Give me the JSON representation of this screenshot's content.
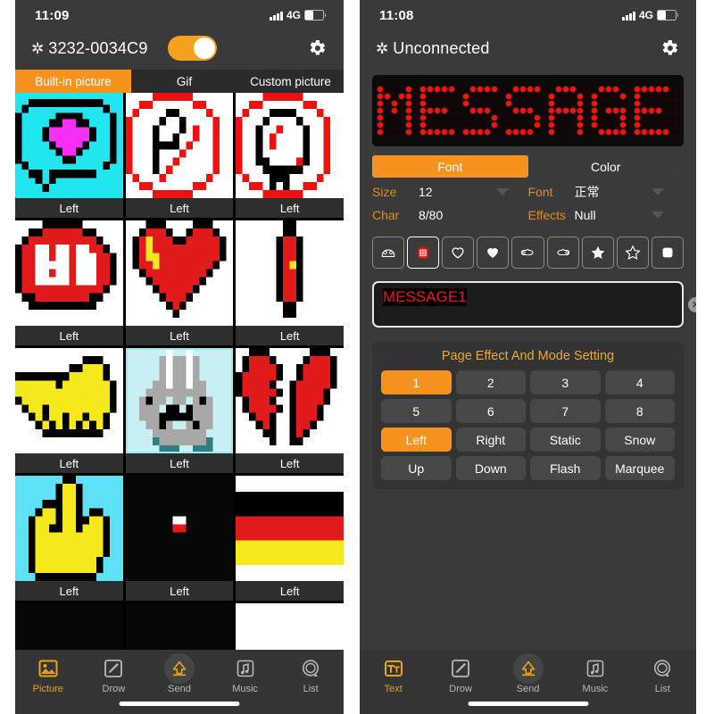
{
  "left": {
    "status": {
      "time": "11:09",
      "network": "4G"
    },
    "device": {
      "name": "3232-0034C9",
      "bluetooth_icon": "bluetooth-icon",
      "toggle_on": true,
      "gear_icon": "gear-icon"
    },
    "tabs": [
      {
        "label": "Built-in picture",
        "active": true
      },
      {
        "label": "Gif",
        "active": false
      },
      {
        "label": "Custom picture",
        "active": false
      }
    ],
    "gallery": [
      {
        "caption": "Left",
        "art": "speech-bubble-heart",
        "selected": false
      },
      {
        "caption": "Left",
        "art": "no-parking",
        "selected": false
      },
      {
        "caption": "Left",
        "art": "no-u-turn",
        "selected": false
      },
      {
        "caption": "Left",
        "art": "stop-sign",
        "selected": false
      },
      {
        "caption": "Left",
        "art": "heart-red",
        "selected": false
      },
      {
        "caption": "Left",
        "art": "vertical-bar",
        "selected": false
      },
      {
        "caption": "Left",
        "art": "handshake",
        "selected": false
      },
      {
        "caption": "Left",
        "art": "rabbit",
        "selected": true
      },
      {
        "caption": "Left",
        "art": "broken-heart",
        "selected": false
      },
      {
        "caption": "Left",
        "art": "pointing-up-hand",
        "selected": false
      },
      {
        "caption": "Left",
        "art": "red-dot",
        "selected": false
      },
      {
        "caption": "Left",
        "art": "flag-germany",
        "selected": false
      },
      {
        "caption": "",
        "art": "red-white-shape",
        "selected": false
      },
      {
        "caption": "",
        "art": "flag-stripes",
        "selected": false
      },
      {
        "caption": "",
        "art": "white-pattern",
        "selected": false
      }
    ],
    "nav": [
      {
        "label": "Picture",
        "icon": "picture-icon",
        "active": true
      },
      {
        "label": "Drow",
        "icon": "pencil-icon",
        "active": false
      },
      {
        "label": "Send",
        "icon": "upload-icon",
        "active": false
      },
      {
        "label": "Music",
        "icon": "music-note-icon",
        "active": false
      },
      {
        "label": "List",
        "icon": "list-circle-icon",
        "active": false
      }
    ]
  },
  "right": {
    "status": {
      "time": "11:08",
      "network": "4G"
    },
    "device": {
      "name": "Unconnected",
      "bluetooth_icon": "bluetooth-icon",
      "gear_icon": "gear-icon"
    },
    "led_preview": {
      "text": "MESSAGE",
      "color": "#ef1515",
      "background": "#0b0b0b"
    },
    "mode_tabs": [
      {
        "label": "Font",
        "active": true
      },
      {
        "label": "Color",
        "active": false
      }
    ],
    "fields": [
      {
        "label": "Size",
        "value": "12",
        "has_caret": true
      },
      {
        "label": "Font",
        "value": "正常",
        "has_caret": true
      },
      {
        "label": "Char",
        "value": "8/80",
        "has_caret": false
      },
      {
        "label": "Effects",
        "value": "Null",
        "has_caret": true
      }
    ],
    "symbol_buttons": [
      {
        "icon": "telephone-outline-icon",
        "active": false
      },
      {
        "icon": "telephone-red-icon",
        "active": true
      },
      {
        "icon": "heart-outline-icon",
        "active": false
      },
      {
        "icon": "heart-filled-icon",
        "active": false
      },
      {
        "icon": "pointing-hand-right-icon",
        "active": false
      },
      {
        "icon": "pointing-hand-left-icon",
        "active": false
      },
      {
        "icon": "star-filled-icon",
        "active": false
      },
      {
        "icon": "star-outline-icon",
        "active": false
      },
      {
        "icon": "rounded-square-icon",
        "active": false
      }
    ],
    "message_input": {
      "value": "MESSAGE1",
      "clear_icon": "clear-circle-icon"
    },
    "effect_panel": {
      "title": "Page Effect And Mode Setting",
      "buttons": [
        {
          "label": "1",
          "active": true
        },
        {
          "label": "2",
          "active": false
        },
        {
          "label": "3",
          "active": false
        },
        {
          "label": "4",
          "active": false
        },
        {
          "label": "5",
          "active": false
        },
        {
          "label": "6",
          "active": false
        },
        {
          "label": "7",
          "active": false
        },
        {
          "label": "8",
          "active": false
        },
        {
          "label": "Left",
          "active": true
        },
        {
          "label": "Right",
          "active": false
        },
        {
          "label": "Static",
          "active": false
        },
        {
          "label": "Snow",
          "active": false
        },
        {
          "label": "Up",
          "active": false
        },
        {
          "label": "Down",
          "active": false
        },
        {
          "label": "Flash",
          "active": false
        },
        {
          "label": "Marquee",
          "active": false
        }
      ]
    },
    "nav": [
      {
        "label": "Text",
        "icon": "text-icon",
        "active": true
      },
      {
        "label": "Drow",
        "icon": "pencil-icon",
        "active": false
      },
      {
        "label": "Send",
        "icon": "upload-icon",
        "active": false
      },
      {
        "label": "Music",
        "icon": "music-note-icon",
        "active": false
      },
      {
        "label": "List",
        "icon": "list-circle-icon",
        "active": false
      }
    ]
  },
  "colors": {
    "accent": "#f5931e",
    "led_red": "#ef1515",
    "panel": "#3a3a3a",
    "label": "#e08b22"
  }
}
